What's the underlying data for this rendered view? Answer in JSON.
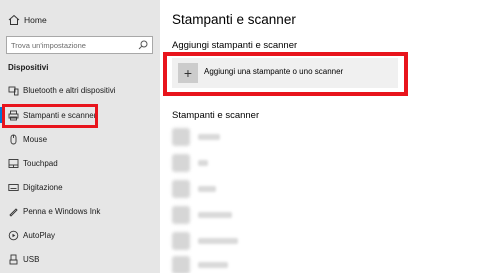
{
  "sidebar": {
    "home_label": "Home",
    "search_placeholder": "Trova un'impostazione",
    "section_title": "Dispositivi",
    "items": [
      {
        "label": "Bluetooth e altri dispositivi",
        "icon": "bluetooth-icon"
      },
      {
        "label": "Stampanti e scanner",
        "icon": "printer-icon",
        "selected": true
      },
      {
        "label": "Mouse",
        "icon": "mouse-icon"
      },
      {
        "label": "Touchpad",
        "icon": "touchpad-icon"
      },
      {
        "label": "Digitazione",
        "icon": "keyboard-icon"
      },
      {
        "label": "Penna e Windows Ink",
        "icon": "pen-icon"
      },
      {
        "label": "AutoPlay",
        "icon": "autoplay-icon"
      },
      {
        "label": "USB",
        "icon": "usb-icon"
      }
    ]
  },
  "main": {
    "title": "Stampanti e scanner",
    "add_section_title": "Aggiungi stampanti e scanner",
    "add_button_label": "Aggiungi una stampante o uno scanner",
    "list_section_title": "Stampanti e scanner"
  },
  "colors": {
    "sidebar_bg": "#e6e6e6",
    "highlight_red": "#e8141c",
    "accent": "#0078d7"
  }
}
